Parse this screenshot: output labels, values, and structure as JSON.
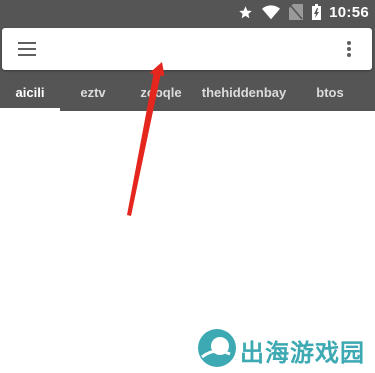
{
  "status_bar": {
    "time": "10:56",
    "icons": [
      "star-icon",
      "wifi-icon",
      "no-sim-icon",
      "battery-charging-icon"
    ]
  },
  "search": {
    "value": "",
    "placeholder": ""
  },
  "tabs": [
    {
      "label": "aicili",
      "active": true
    },
    {
      "label": "eztv",
      "active": false
    },
    {
      "label": "zooqle",
      "active": false
    },
    {
      "label": "thehiddenbay",
      "active": false
    },
    {
      "label": "btos",
      "active": false
    }
  ],
  "watermark": {
    "text": "出海游戏园"
  },
  "colors": {
    "app_bar": "#555555",
    "annotation_arrow": "#e5261e",
    "watermark": "#3da9b3"
  }
}
